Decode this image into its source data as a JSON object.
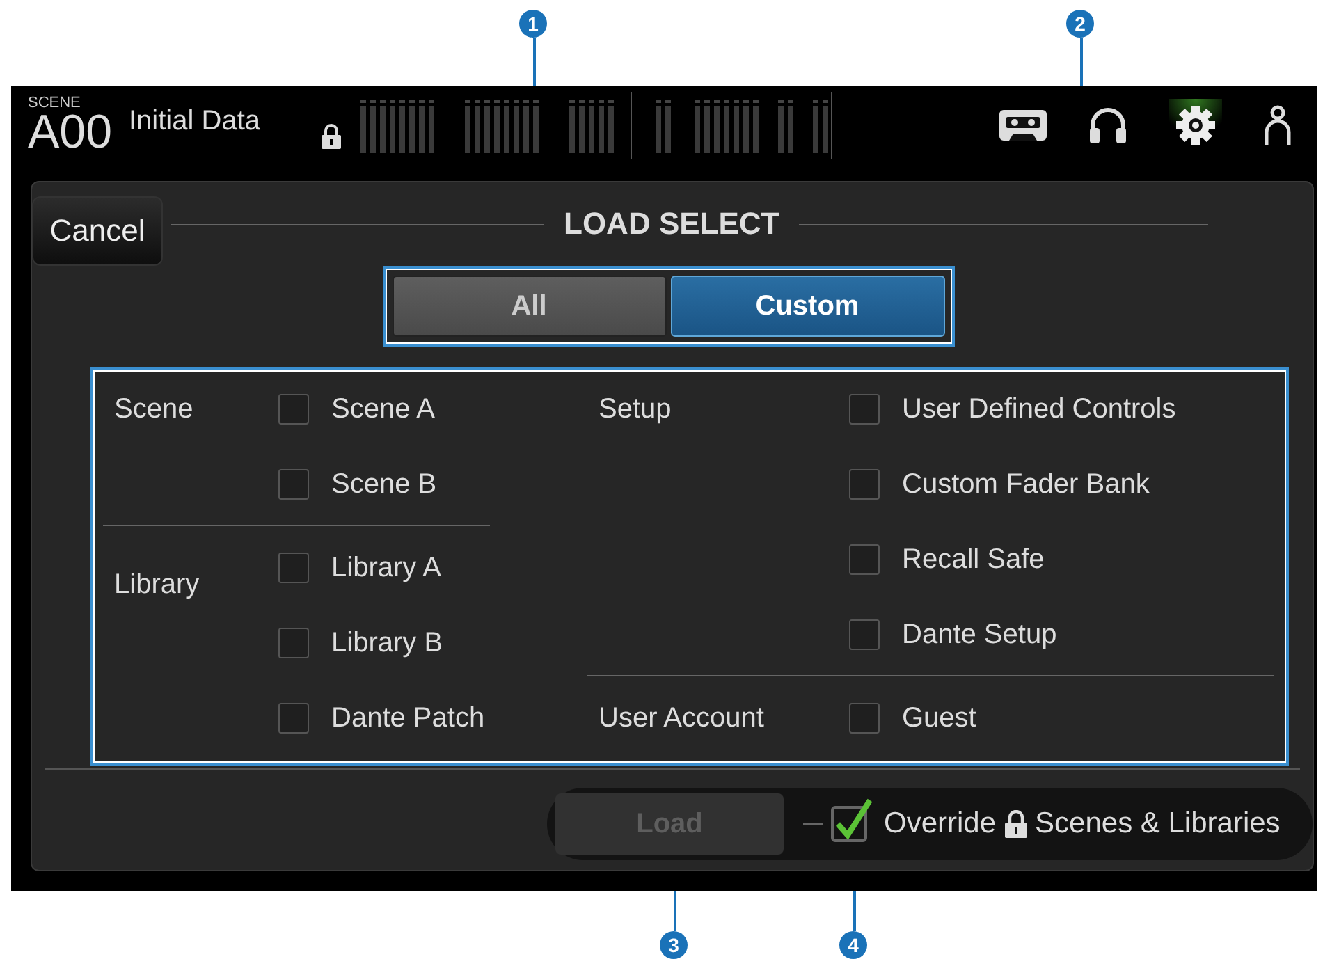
{
  "callouts": [
    {
      "label": "1"
    },
    {
      "label": "2"
    },
    {
      "label": "3"
    },
    {
      "label": "4"
    }
  ],
  "header": {
    "scene_label": "SCENE",
    "scene_number": "A00",
    "scene_name": "Initial Data"
  },
  "dialog": {
    "cancel": "Cancel",
    "title": "LOAD SELECT",
    "mode_tabs": [
      {
        "label": "All",
        "selected": false
      },
      {
        "label": "Custom",
        "selected": true
      }
    ],
    "left_groups": [
      {
        "label": "Scene",
        "items": [
          {
            "label": "Scene A",
            "checked": false
          },
          {
            "label": "Scene B",
            "checked": false
          }
        ]
      },
      {
        "label": "Library",
        "items": [
          {
            "label": "Library A",
            "checked": false
          },
          {
            "label": "Library B",
            "checked": false
          },
          {
            "label": "Dante Patch",
            "checked": false
          }
        ]
      }
    ],
    "right_groups": [
      {
        "label": "Setup",
        "items": [
          {
            "label": "User Defined Controls",
            "checked": false
          },
          {
            "label": "Custom Fader Bank",
            "checked": false
          },
          {
            "label": "Recall Safe",
            "checked": false
          },
          {
            "label": "Dante Setup",
            "checked": false
          }
        ]
      },
      {
        "label": "User Account",
        "items": [
          {
            "label": "Guest",
            "checked": false
          }
        ]
      }
    ],
    "load_button": {
      "label": "Load",
      "disabled": true
    },
    "override": {
      "checked": true,
      "text_before": "Override",
      "text_after": "Scenes & Libraries"
    }
  }
}
